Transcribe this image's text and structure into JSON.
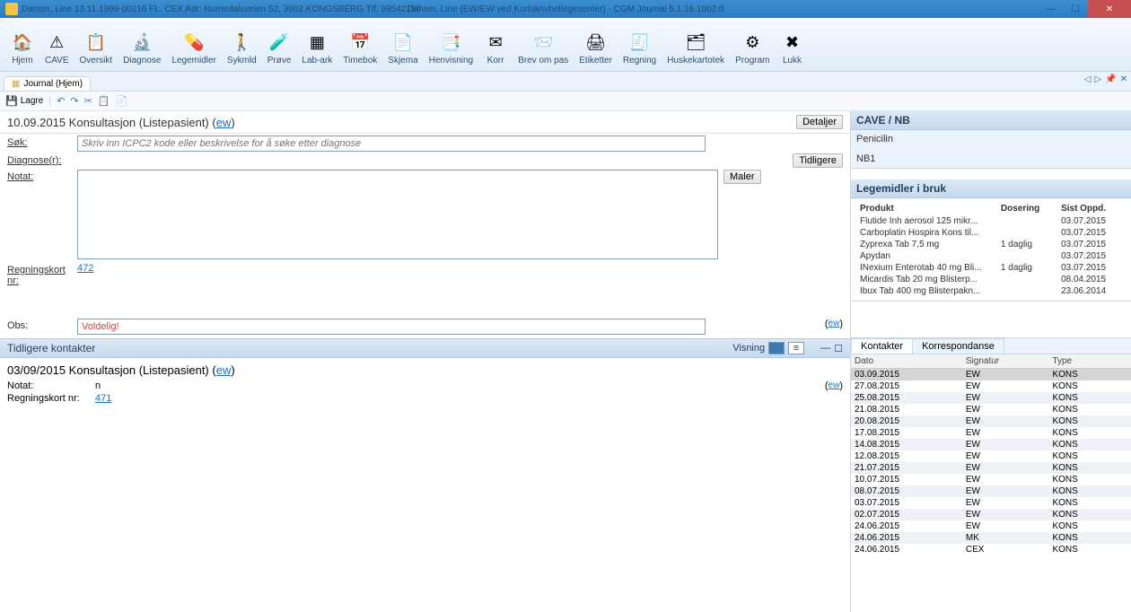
{
  "window": {
    "title_left": "Danser, Line 13.11.1969-00216 FL: CEX Adr: Numedalsveien 52, 3602 KONGSBERG Tlf: 98542150",
    "title_center": "Danser, Line (EW/EW ved Kortskrivhellegesenter) - CGM Journal 5.1.16.1002.0"
  },
  "ribbon": [
    {
      "label": "Hjem",
      "icon": "home"
    },
    {
      "label": "CAVE",
      "icon": "warn"
    },
    {
      "label": "Oversikt",
      "icon": "clipboard"
    },
    {
      "label": "Diagnose",
      "icon": "stetho"
    },
    {
      "label": "Legemidler",
      "icon": "pill"
    },
    {
      "label": "Sykmld",
      "icon": "person"
    },
    {
      "label": "Prøve",
      "icon": "tube"
    },
    {
      "label": "Lab-ark",
      "icon": "grid"
    },
    {
      "label": "Timebok",
      "icon": "cal"
    },
    {
      "label": "Skjema",
      "icon": "doc"
    },
    {
      "label": "Henvisning",
      "icon": "ref"
    },
    {
      "label": "Korr",
      "icon": "mail"
    },
    {
      "label": "Brev om pas",
      "icon": "letter"
    },
    {
      "label": "Etiketter",
      "icon": "print"
    },
    {
      "label": "Regning",
      "icon": "bill"
    },
    {
      "label": "Huskekartotek",
      "icon": "index"
    },
    {
      "label": "Program",
      "icon": "gear"
    },
    {
      "label": "Lukk",
      "icon": "close"
    }
  ],
  "tab": {
    "label": "Journal (Hjem)"
  },
  "toolbar": {
    "save": "Lagre"
  },
  "consult": {
    "title": "10.09.2015 Konsultasjon (Listepasient)",
    "sig": "ew",
    "details_btn": "Detaljer",
    "labels": {
      "sok": "Søk:",
      "diag": "Diagnose(r):",
      "notat": "Notat:",
      "regn": "Regningskort nr:",
      "obs": "Obs:"
    },
    "sok_placeholder": "Skriv inn ICPC2 kode eller beskrivelse for å søke etter diagnose",
    "regn_nr": "472",
    "obs_value": "Voldelig!",
    "obs_sig": "ew",
    "btn_tidligere": "Tidligere",
    "btn_maler": "Maler"
  },
  "prev_section": {
    "title": "Tidligere kontakter",
    "visning": "Visning"
  },
  "prev_entry": {
    "title": "03/09/2015 Konsultasjon (Listepasient)",
    "sig": "ew",
    "notat_label": "Notat:",
    "notat_value": "n",
    "notat_sig": "ew",
    "regn_label": "Regningskort nr:",
    "regn_nr": "471"
  },
  "cave": {
    "header": "CAVE / NB",
    "items": [
      "Penicilin",
      "NB1"
    ]
  },
  "meds": {
    "header": "Legemidler i bruk",
    "cols": [
      "Produkt",
      "Dosering",
      "Sist Oppd."
    ],
    "rows": [
      [
        "Flutide Inh aerosol 125 mikr...",
        "",
        "03.07.2015"
      ],
      [
        "Carboplatin Hospira Kons til...",
        "",
        "03.07.2015"
      ],
      [
        "Zyprexa Tab 7,5 mg",
        "1 daglig",
        "03.07.2015"
      ],
      [
        "Apydan",
        "",
        "03.07.2015"
      ],
      [
        "INexium Enterotab 40 mg Bli...",
        "1 daglig",
        "03.07.2015"
      ],
      [
        "Micardis Tab 20 mg Blisterp...",
        "",
        "08.04.2015"
      ],
      [
        "Ibux Tab 400 mg Blisterpakn...",
        "",
        "23.06.2014"
      ]
    ]
  },
  "contacts": {
    "tabs": [
      "Kontakter",
      "Korrespondanse"
    ],
    "cols": [
      "Dato",
      "Signatur",
      "Type"
    ],
    "rows": [
      [
        "03.09.2015",
        "EW",
        "KONS"
      ],
      [
        "27.08.2015",
        "EW",
        "KONS"
      ],
      [
        "25.08.2015",
        "EW",
        "KONS"
      ],
      [
        "21.08.2015",
        "EW",
        "KONS"
      ],
      [
        "20.08.2015",
        "EW",
        "KONS"
      ],
      [
        "17.08.2015",
        "EW",
        "KONS"
      ],
      [
        "14.08.2015",
        "EW",
        "KONS"
      ],
      [
        "12.08.2015",
        "EW",
        "KONS"
      ],
      [
        "21.07.2015",
        "EW",
        "KONS"
      ],
      [
        "10.07.2015",
        "EW",
        "KONS"
      ],
      [
        "08.07.2015",
        "EW",
        "KONS"
      ],
      [
        "03.07.2015",
        "EW",
        "KONS"
      ],
      [
        "02.07.2015",
        "EW",
        "KONS"
      ],
      [
        "24.06.2015",
        "EW",
        "KONS"
      ],
      [
        "24.06.2015",
        "MK",
        "KONS"
      ],
      [
        "24.06.2015",
        "CEX",
        "KONS"
      ]
    ]
  }
}
